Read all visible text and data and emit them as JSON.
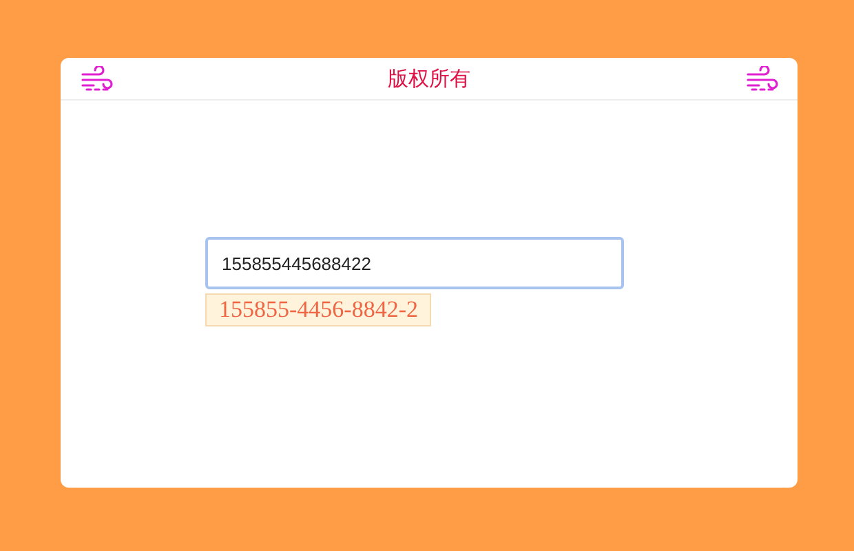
{
  "header": {
    "title": "版权所有"
  },
  "input": {
    "value": "155855445688422"
  },
  "formatted": "155855-4456-8842-2"
}
